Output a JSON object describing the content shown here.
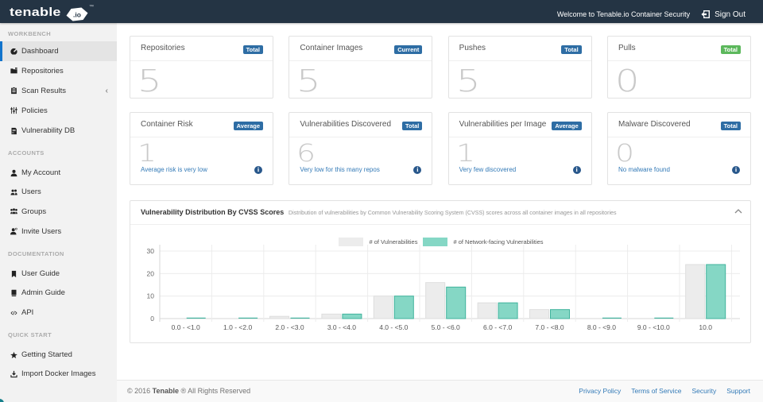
{
  "topbar": {
    "logo_text": "tenable",
    "logo_io": ".io",
    "logo_tm": "TM",
    "welcome": "Welcome to Tenable.io Container Security",
    "signout": "Sign Out"
  },
  "sidebar": {
    "sections": [
      {
        "header": "WORKBENCH",
        "items": [
          {
            "label": "Dashboard",
            "icon": "dashboard-icon",
            "active": true
          },
          {
            "label": "Repositories",
            "icon": "repositories-icon"
          },
          {
            "label": "Scan Results",
            "icon": "scan-results-icon",
            "chevron": "‹"
          },
          {
            "label": "Policies",
            "icon": "policies-icon"
          },
          {
            "label": "Vulnerability DB",
            "icon": "vulnerability-db-icon"
          }
        ]
      },
      {
        "header": "ACCOUNTS",
        "items": [
          {
            "label": "My Account",
            "icon": "my-account-icon"
          },
          {
            "label": "Users",
            "icon": "users-icon"
          },
          {
            "label": "Groups",
            "icon": "groups-icon"
          },
          {
            "label": "Invite Users",
            "icon": "invite-users-icon"
          }
        ]
      },
      {
        "header": "DOCUMENTATION",
        "items": [
          {
            "label": "User Guide",
            "icon": "user-guide-icon"
          },
          {
            "label": "Admin Guide",
            "icon": "admin-guide-icon"
          },
          {
            "label": "API",
            "icon": "api-icon"
          }
        ]
      },
      {
        "header": "QUICK START",
        "items": [
          {
            "label": "Getting Started",
            "icon": "getting-started-icon"
          },
          {
            "label": "Import Docker Images",
            "icon": "import-docker-images-icon"
          }
        ]
      }
    ]
  },
  "cards_row1": [
    {
      "title": "Repositories",
      "badge": "Total",
      "badge_color": "#2e6da4",
      "value": "5"
    },
    {
      "title": "Container Images",
      "badge": "Current",
      "badge_color": "#2e6da4",
      "value": "5"
    },
    {
      "title": "Pushes",
      "badge": "Total",
      "badge_color": "#2e6da4",
      "value": "5"
    },
    {
      "title": "Pulls",
      "badge": "Total",
      "badge_color": "#5cb85c",
      "value": "0"
    }
  ],
  "cards_row2": [
    {
      "title": "Container Risk",
      "badge": "Average",
      "badge_color": "#2e6da4",
      "value": "1",
      "note": "Average risk is very low"
    },
    {
      "title": "Vulnerabilities Discovered",
      "badge": "Total",
      "badge_color": "#2e6da4",
      "value": "6",
      "note": "Very low for this many repos"
    },
    {
      "title": "Vulnerabilities per Image",
      "badge": "Average",
      "badge_color": "#2e6da4",
      "value": "1",
      "note": "Very few discovered"
    },
    {
      "title": "Malware Discovered",
      "badge": "Total",
      "badge_color": "#2e6da4",
      "value": "0",
      "note": "No malware found"
    }
  ],
  "chart_card": {
    "title": "Vulnerability Distribution By CVSS Scores",
    "subtitle": "Distribution of vulnerabilities by Common Vulnerability Scoring System (CVSS) scores across all container images in all repositories"
  },
  "chart_data": {
    "type": "bar",
    "categories": [
      "0.0 - <1.0",
      "1.0 - <2.0",
      "2.0 - <3.0",
      "3.0 - <4.0",
      "4.0 - <5.0",
      "5.0 - <6.0",
      "6.0 - <7.0",
      "7.0 - <8.0",
      "8.0 - <9.0",
      "9.0 - <10.0",
      "10.0"
    ],
    "series": [
      {
        "name": "# of Vulnerabilities",
        "color": "#ececec",
        "border": "#dedede",
        "values": [
          0,
          0,
          1,
          2,
          10,
          16,
          7,
          4,
          0,
          0,
          24
        ]
      },
      {
        "name": "# of Network-facing Vulnerabilities",
        "color": "#85d7c5",
        "border": "#41b39d",
        "values": [
          0,
          0,
          0,
          2,
          10,
          14,
          7,
          4,
          0,
          0,
          24
        ]
      }
    ],
    "ylim": [
      0,
      30
    ],
    "yticks": [
      0,
      10,
      20,
      30
    ],
    "grid": true,
    "legend_position": "top"
  },
  "footer": {
    "copyright_prefix": "© 2016 ",
    "copyright_bold": "Tenable",
    "copyright_suffix": " ® All Rights Reserved",
    "links": [
      "Privacy Policy",
      "Terms of Service",
      "Security",
      "Support"
    ]
  }
}
